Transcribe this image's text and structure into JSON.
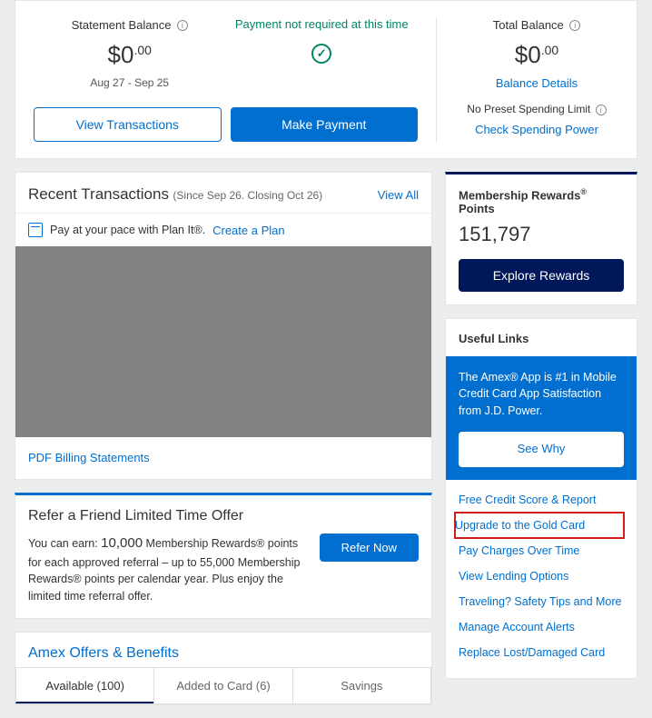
{
  "top": {
    "statement_label": "Statement Balance",
    "statement_amount_whole": "$0",
    "statement_amount_cents": ".00",
    "statement_period": "Aug 27 - Sep 25",
    "payment_msg": "Payment not required at this time",
    "total_label": "Total Balance",
    "total_amount_whole": "$0",
    "total_amount_cents": ".00",
    "balance_details": "Balance Details",
    "no_preset": "No Preset Spending Limit",
    "check_spending": "Check Spending Power",
    "view_tx_btn": "View Transactions",
    "make_payment_btn": "Make Payment"
  },
  "recent": {
    "title": "Recent Transactions",
    "subtitle": "(Since Sep 26. Closing Oct 26)",
    "view_all": "View All",
    "planit_text": "Pay at your pace with Plan It®.",
    "planit_link": "Create a Plan",
    "pdf_link": "PDF Billing Statements"
  },
  "refer": {
    "heading": "Refer a Friend Limited Time Offer",
    "body_pre": "You can earn: ",
    "body_big": "10,000",
    "body_post": " Membership Rewards® points for each approved referral – up to 55,000 Membership Rewards® points per calendar year. Plus enjoy the limited time referral offer.",
    "btn": "Refer Now"
  },
  "offers": {
    "heading": "Amex Offers & Benefits",
    "tab_available": "Available (100)",
    "tab_added": "Added to Card (6)",
    "tab_savings": "Savings"
  },
  "rewards": {
    "title_pre": "Membership Rewards",
    "title_post": " Points",
    "points": "151,797",
    "explore_btn": "Explore Rewards"
  },
  "useful": {
    "heading": "Useful Links",
    "promo_text": "The Amex® App is #1 in Mobile Credit Card App Satisfaction from J.D. Power.",
    "see_why": "See Why",
    "links": {
      "0": "Free Credit Score & Report",
      "1": "Upgrade to the Gold Card",
      "2": "Pay Charges Over Time",
      "3": "View Lending Options",
      "4": "Traveling? Safety Tips and More",
      "5": "Manage Account Alerts",
      "6": "Replace Lost/Damaged Card"
    }
  }
}
